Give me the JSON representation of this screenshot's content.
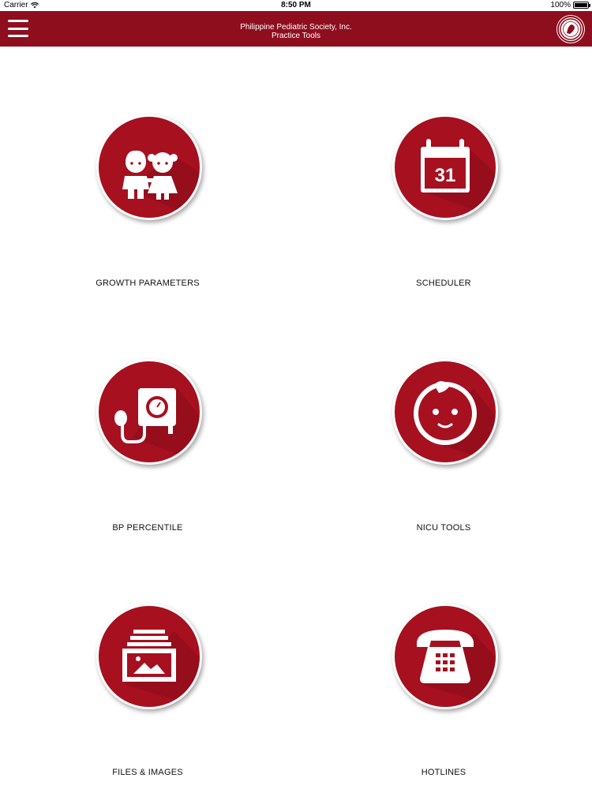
{
  "status_bar": {
    "carrier": "Carrier",
    "time": "8:50 PM",
    "battery": "100%"
  },
  "header": {
    "title_line1": "Philippine Pediatric Society, Inc.",
    "title_line2": "Practice Tools",
    "brand_color": "#8f0e1e"
  },
  "tiles": [
    {
      "label": "GROWTH PARAMETERS",
      "icon": "children-icon"
    },
    {
      "label": "SCHEDULER",
      "icon": "calendar-icon",
      "calendar_day": "31"
    },
    {
      "label": "BP PERCENTILE",
      "icon": "blood-pressure-icon"
    },
    {
      "label": "NICU TOOLS",
      "icon": "baby-face-icon"
    },
    {
      "label": "FILES & IMAGES",
      "icon": "image-files-icon"
    },
    {
      "label": "HOTLINES",
      "icon": "telephone-icon"
    }
  ],
  "colors": {
    "circle": "#a6101f",
    "shadow": "#7c0a16"
  }
}
